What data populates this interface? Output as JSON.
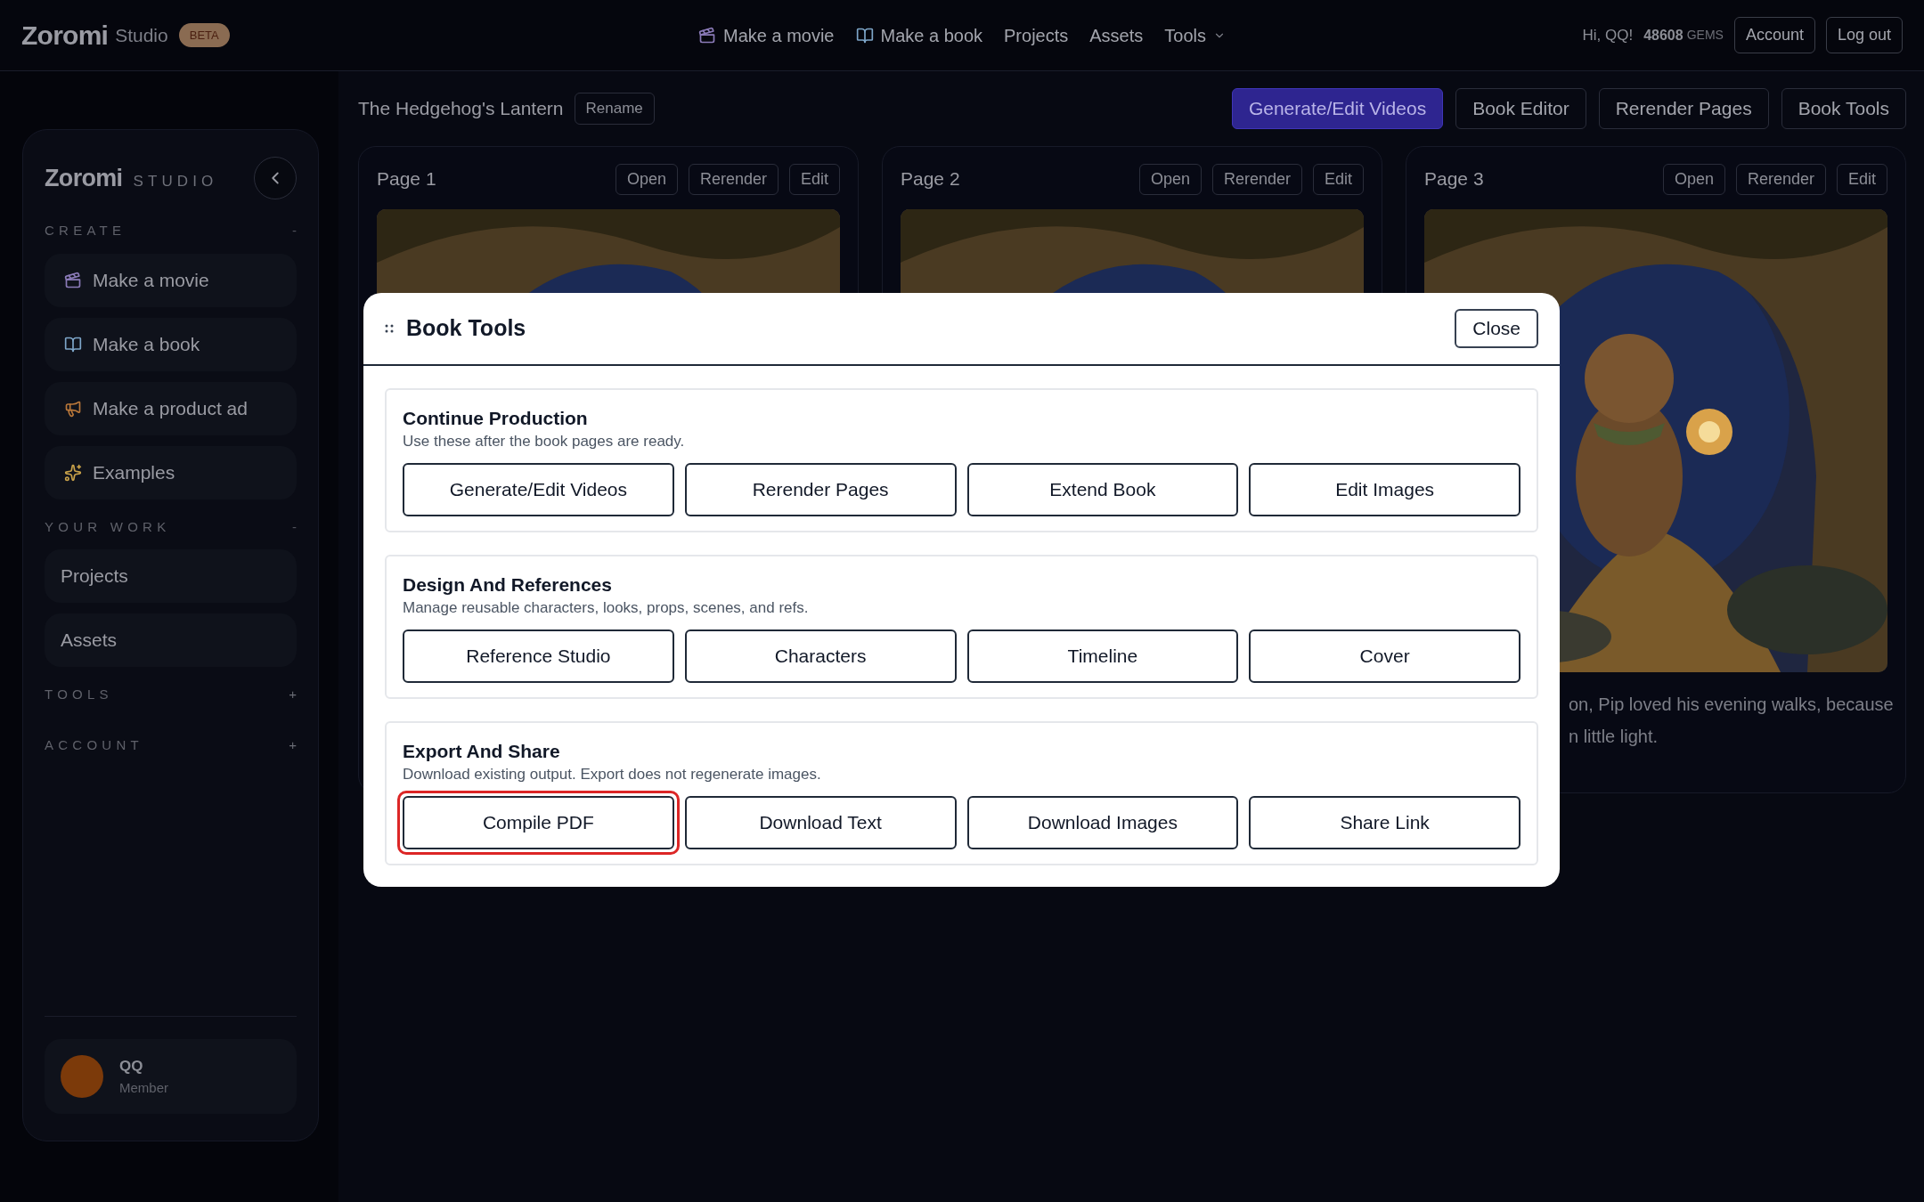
{
  "topbar": {
    "logo": "Zoromi",
    "logo_sub": "Studio",
    "badge": "BETA",
    "nav": [
      {
        "label": "Make a movie",
        "kind": "movie"
      },
      {
        "label": "Make a book",
        "kind": "book"
      },
      {
        "label": "Projects",
        "kind": "plain"
      },
      {
        "label": "Assets",
        "kind": "plain"
      },
      {
        "label": "Tools",
        "kind": "menu"
      }
    ],
    "greeting": "Hi, QQ!",
    "gems": "48608",
    "gems_unit": "GEMS",
    "buttons": [
      "Account",
      "Log out"
    ]
  },
  "project": {
    "title": "The Hedgehog's Lantern",
    "rename": "Rename",
    "actions": [
      {
        "label": "Generate/Edit Videos",
        "selected": true
      },
      {
        "label": "Book Editor",
        "selected": false
      },
      {
        "label": "Rerender Pages",
        "selected": false
      },
      {
        "label": "Book Tools",
        "selected": false
      }
    ]
  },
  "sidebar": {
    "logo": "Zoromi",
    "logo_sub": "STUDIO",
    "sections": [
      {
        "title": "CREATE",
        "toggle": "-",
        "expanded": true,
        "items": [
          {
            "label": "Make a movie",
            "kind": "movie"
          },
          {
            "label": "Make a book",
            "kind": "book"
          },
          {
            "label": "Make a product ad",
            "kind": "ad"
          },
          {
            "label": "Examples",
            "kind": "sparkle"
          }
        ]
      },
      {
        "title": "YOUR WORK",
        "toggle": "-",
        "expanded": true,
        "items": [
          {
            "label": "Projects",
            "kind": "plain"
          },
          {
            "label": "Assets",
            "kind": "plain"
          }
        ]
      },
      {
        "title": "TOOLS",
        "toggle": "+",
        "expanded": false
      },
      {
        "title": "ACCOUNT",
        "toggle": "+",
        "expanded": false
      }
    ],
    "user": {
      "name": "QQ",
      "role": "Member",
      "color": "#7c3a0a"
    }
  },
  "pages": [
    {
      "title": "Page 1",
      "buttons": [
        "Open",
        "Rerender",
        "Edit"
      ]
    },
    {
      "title": "Page 2",
      "buttons": [
        "Open",
        "Rerender",
        "Edit"
      ]
    },
    {
      "title": "Page 3",
      "buttons": [
        "Open",
        "Rerender",
        "Edit"
      ],
      "caption": [
        "on, Pip loved his evening walks, because",
        "n little light."
      ]
    }
  ],
  "dialog": {
    "title": "Book Tools",
    "close": "Close",
    "sections": [
      {
        "title": "Continue Production",
        "description": "Use these after the book pages are ready.",
        "buttons": [
          {
            "label": "Generate/Edit Videos",
            "highlighted": false
          },
          {
            "label": "Rerender Pages",
            "highlighted": false
          },
          {
            "label": "Extend Book",
            "highlighted": false
          },
          {
            "label": "Edit Images",
            "highlighted": false
          }
        ]
      },
      {
        "title": "Design And References",
        "description": "Manage reusable characters, looks, props, scenes, and refs.",
        "buttons": [
          {
            "label": "Reference Studio",
            "highlighted": false
          },
          {
            "label": "Characters",
            "highlighted": false
          },
          {
            "label": "Timeline",
            "highlighted": false
          },
          {
            "label": "Cover",
            "highlighted": false
          }
        ]
      },
      {
        "title": "Export And Share",
        "description": "Download existing output. Export does not regenerate images.",
        "buttons": [
          {
            "label": "Compile PDF",
            "highlighted": true
          },
          {
            "label": "Download Text",
            "highlighted": false
          },
          {
            "label": "Download Images",
            "highlighted": false
          },
          {
            "label": "Share Link",
            "highlighted": false
          }
        ]
      }
    ]
  }
}
